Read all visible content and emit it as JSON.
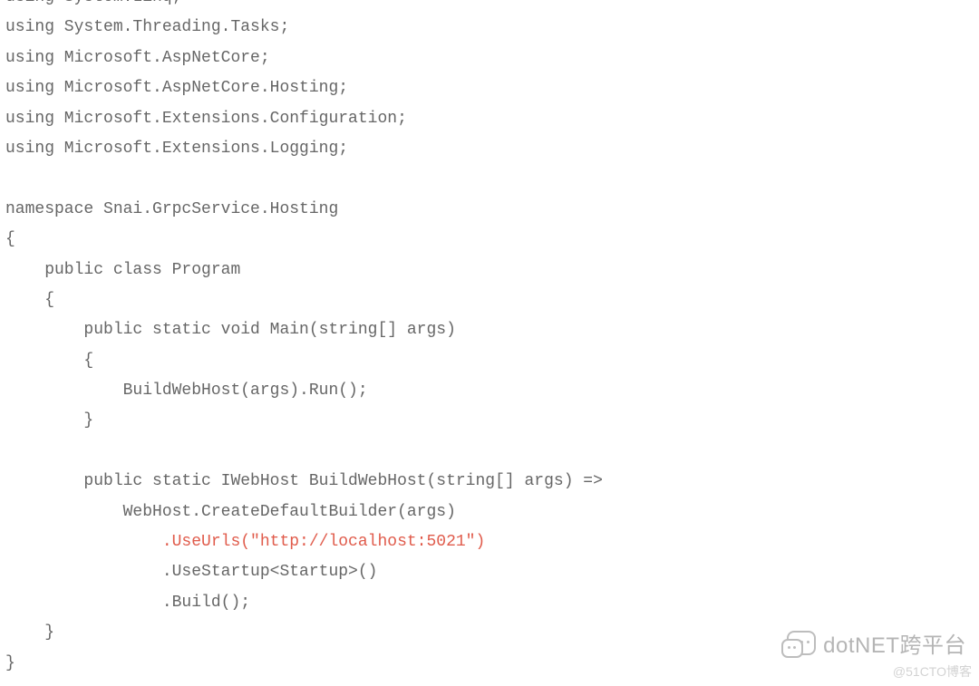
{
  "code": {
    "lines": [
      "using System.Linq;",
      "using System.Threading.Tasks;",
      "using Microsoft.AspNetCore;",
      "using Microsoft.AspNetCore.Hosting;",
      "using Microsoft.Extensions.Configuration;",
      "using Microsoft.Extensions.Logging;",
      "",
      "namespace Snai.GrpcService.Hosting",
      "{",
      "    public class Program",
      "    {",
      "        public static void Main(string[] args)",
      "        {",
      "            BuildWebHost(args).Run();",
      "        }",
      "",
      "        public static IWebHost BuildWebHost(string[] args) =>",
      "            WebHost.CreateDefaultBuilder(args)",
      "                .UseUrls(\"http://localhost:5021\")",
      "                .UseStartup<Startup>()",
      "                .Build();",
      "    }",
      "}"
    ],
    "highlight_line_index": 18
  },
  "watermark": {
    "brand": "dotNET跨平台",
    "blog": "@51CTO博客"
  }
}
